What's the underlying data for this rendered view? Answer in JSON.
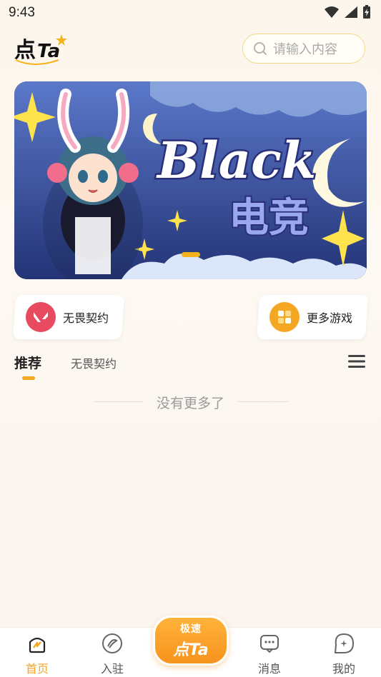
{
  "status_bar": {
    "time": "9:43"
  },
  "header": {
    "logo_text": "点Ta",
    "search_placeholder": "请输入内容"
  },
  "banner": {
    "title": "Black",
    "subtitle": "电竞"
  },
  "quick_tiles": [
    {
      "label": "无畏契约",
      "icon": "valorant-icon"
    },
    {
      "label": "更多游戏",
      "icon": "more-games-icon"
    }
  ],
  "tabs": [
    {
      "label": "推荐",
      "active": true
    },
    {
      "label": "无畏契约",
      "active": false
    }
  ],
  "empty_state": {
    "text": "没有更多了"
  },
  "bottom_nav": {
    "items": [
      {
        "label": "首页",
        "icon": "home-icon",
        "active": true
      },
      {
        "label": "入驻",
        "icon": "join-icon",
        "active": false
      },
      {
        "label": "消息",
        "icon": "message-icon",
        "active": false
      },
      {
        "label": "我的",
        "icon": "profile-icon",
        "active": false
      }
    ],
    "center_button": {
      "top": "极速",
      "bottom": "点Ta"
    }
  },
  "colors": {
    "accent": "#f5a623",
    "search_border": "#f1d98a",
    "banner_bg": "#2b3a8c"
  }
}
